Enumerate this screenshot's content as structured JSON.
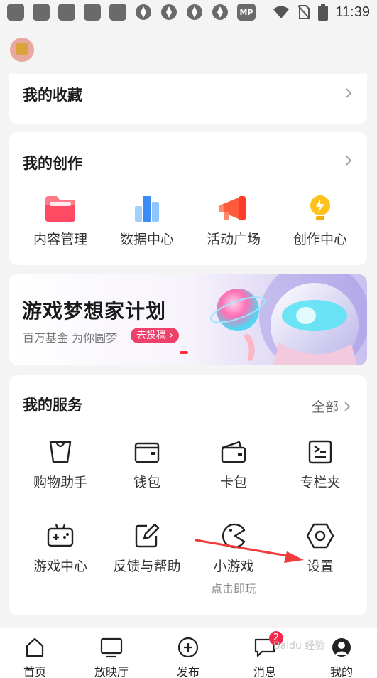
{
  "status_bar": {
    "time": "11:39",
    "mp_label": "MP"
  },
  "favorites": {
    "title": "我的收藏"
  },
  "creation": {
    "title": "我的创作",
    "items": [
      {
        "label": "内容管理",
        "icon": "folder-icon"
      },
      {
        "label": "数据中心",
        "icon": "bar-chart-icon"
      },
      {
        "label": "活动广场",
        "icon": "megaphone-icon"
      },
      {
        "label": "创作中心",
        "icon": "lightbulb-icon"
      }
    ]
  },
  "banner": {
    "title": "游戏梦想家计划",
    "subtitle": "百万基金 为你圆梦",
    "button": "去投稿"
  },
  "services": {
    "title": "我的服务",
    "all_link": "全部",
    "items": [
      {
        "label": "购物助手",
        "icon": "shopping-bag-icon"
      },
      {
        "label": "钱包",
        "icon": "wallet-icon"
      },
      {
        "label": "卡包",
        "icon": "card-wallet-icon"
      },
      {
        "label": "专栏夹",
        "icon": "column-folder-icon"
      },
      {
        "label": "游戏中心",
        "icon": "gamepad-icon"
      },
      {
        "label": "反馈与帮助",
        "icon": "edit-icon"
      },
      {
        "label": "小游戏",
        "sublabel": "点击即玩",
        "icon": "pacman-icon"
      },
      {
        "label": "设置",
        "icon": "settings-hexagon-icon"
      }
    ]
  },
  "tabbar": {
    "items": [
      {
        "label": "首页",
        "icon": "home-icon"
      },
      {
        "label": "放映厅",
        "icon": "tv-icon"
      },
      {
        "label": "发布",
        "icon": "plus-circle-icon"
      },
      {
        "label": "消息",
        "icon": "message-icon",
        "badge": "2"
      },
      {
        "label": "我的",
        "icon": "avatar-icon"
      }
    ]
  },
  "watermark": "Baidu 经验",
  "colors": {
    "accent": "#ef3f6a",
    "badge": "#f2294b",
    "arrow": "#f03c3c"
  }
}
